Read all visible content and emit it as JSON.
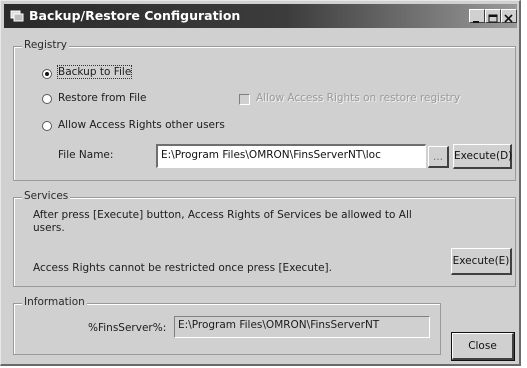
{
  "window": {
    "title": "Backup/Restore Configuration"
  },
  "registry": {
    "label": "Registry",
    "options": [
      {
        "label": "Backup to File",
        "selected": true
      },
      {
        "label": "Restore from File",
        "selected": false
      },
      {
        "label": "Allow Access Rights other users",
        "selected": false
      }
    ],
    "checkbox_label": "Allow Access Rights on restore registry",
    "file_name_label": "File Name:",
    "file_name_value": "E:\\Program Files\\OMRON\\FinsServerNT\\loc",
    "browse_label": "...",
    "execute_label": "Execute(D)"
  },
  "services": {
    "label": "Services",
    "description": "After press [Execute] button, Access Rights of Services be allowed to All users.",
    "warning": "Access Rights cannot be restricted once press [Execute].",
    "execute_label": "Execute(E)"
  },
  "information": {
    "label": "Information",
    "field_label": "%FinsServer%:",
    "field_value": "E:\\Program Files\\OMRON\\FinsServerNT"
  },
  "close_label": "Close"
}
